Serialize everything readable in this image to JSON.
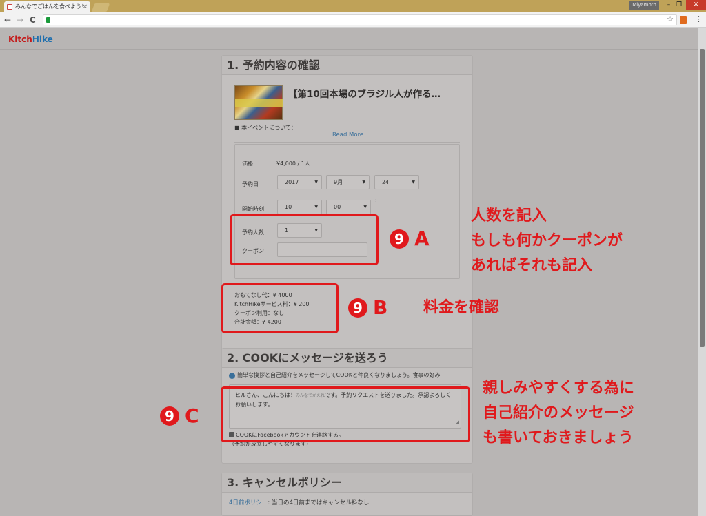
{
  "browser": {
    "tab_title": "みんなでごはんを食べよう！",
    "tab_close": "×",
    "user_name": "Miyamoto",
    "win_min": "–",
    "win_max": "❐",
    "win_close": "✕",
    "back": "←",
    "forward": "→",
    "reload": "C",
    "star": "☆",
    "menu": "⋮"
  },
  "site": {
    "logo_kitch": "Kitch",
    "logo_hike": "Hike"
  },
  "section1": {
    "heading": "1. 予約内容の確認",
    "event_title": "【第10回本場のブラジル人が作る…",
    "about": "■ 本イベントについて：",
    "read_more": "Read More",
    "price_label": "価格",
    "price_value": "¥4,000 / 1人",
    "date_label": "予約日",
    "date_year": "2017",
    "date_month": "9月",
    "date_day": "24",
    "time_label": "開始時刻",
    "time_hour": "10",
    "time_minute": "00",
    "time_colon": ":",
    "people_label": "予約人数",
    "people_value": "1",
    "coupon_label": "クーポン",
    "coupon_value": "",
    "fee_omotenashi": "おもてなし代：¥ 4000",
    "fee_service": "KitchHikeサービス料：¥ 200",
    "fee_coupon": "クーポン利用：なし",
    "fee_total": "合計金額：¥ 4200"
  },
  "section2": {
    "heading": "2. COOKにメッセージを送ろう",
    "info_icon": "i",
    "info_text": "簡単な挨拶と自己紹介をメッセージしてCOOKと仲良くなりましょう。食事の好み",
    "message_before": "ヒルさん、こんにちは！",
    "message_small": "みんなでかえれ",
    "message_after": "です。予約リクエストを送りました。承認よろしくお願いします。",
    "grip": "◢",
    "facebook_line": "COOKにFacebookアカウントを連絡する。",
    "facebook_note": "（予約が成立しやすくなります）"
  },
  "section3": {
    "heading": "3. キャンセルポリシー",
    "policy_link": "4日前ポリシー",
    "policy_text": ": 当日の4日前まではキャンセル料なし"
  },
  "annotations": {
    "a_num": "9",
    "a_letter": "A",
    "a_note_1": "人数を記入",
    "a_note_2": "もしも何かクーポンが",
    "a_note_3": "あればそれも記入",
    "b_num": "9",
    "b_letter": "B",
    "b_note": "料金を確認",
    "c_num": "9",
    "c_letter": "C",
    "c_note_1": "親しみやすくする為に",
    "c_note_2": "自己紹介のメッセージ",
    "c_note_3": "も書いておきましょう",
    "color": "#e0191c"
  }
}
